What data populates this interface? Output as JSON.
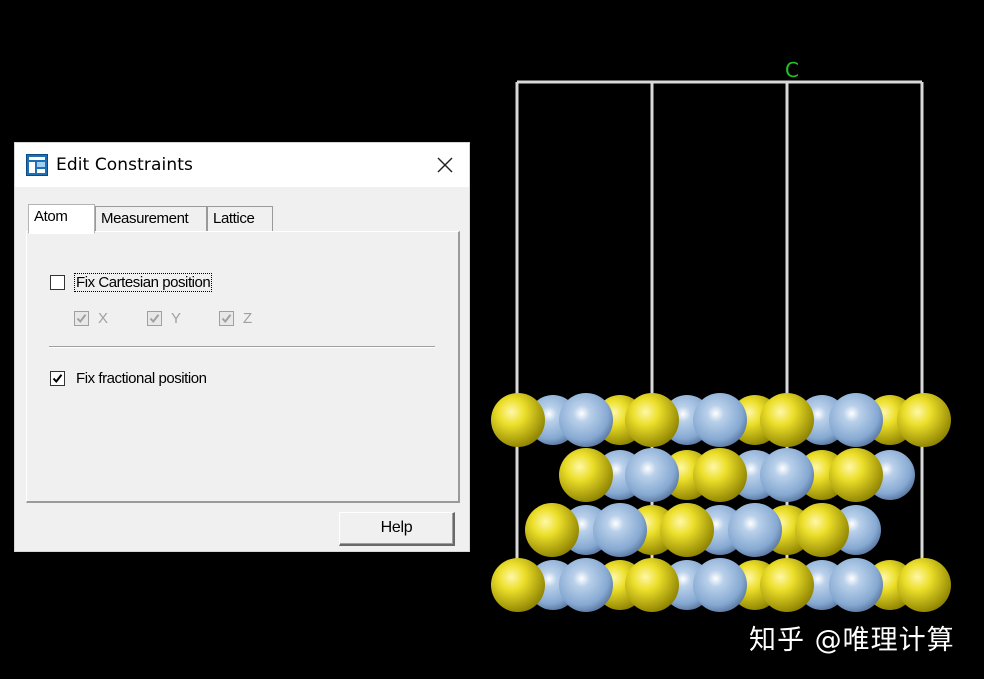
{
  "dialog": {
    "title": "Edit Constraints",
    "icon": "materials-studio-app-icon",
    "close_icon": "close-icon",
    "tabs": [
      {
        "label": "Atom",
        "active": true
      },
      {
        "label": "Measurement",
        "active": false
      },
      {
        "label": "Lattice",
        "active": false
      }
    ],
    "atom_tab": {
      "fix_cartesian": {
        "label": "Fix Cartesian position",
        "checked": false
      },
      "axes": [
        {
          "label": "X",
          "checked": true,
          "enabled": false
        },
        {
          "label": "Y",
          "checked": true,
          "enabled": false
        },
        {
          "label": "Z",
          "checked": true,
          "enabled": false
        }
      ],
      "fix_fractional": {
        "label": "Fix fractional position",
        "checked": true
      }
    },
    "help_label": "Help"
  },
  "viewer": {
    "axis_label": "C",
    "colors": {
      "background": "#000000",
      "cell_lines": "#d9d9d9",
      "axis_label": "#22c322",
      "atom_yellow": "#e6d81c",
      "atom_blue": "#8fb2d8"
    }
  },
  "watermark": "知乎 @唯理计算"
}
